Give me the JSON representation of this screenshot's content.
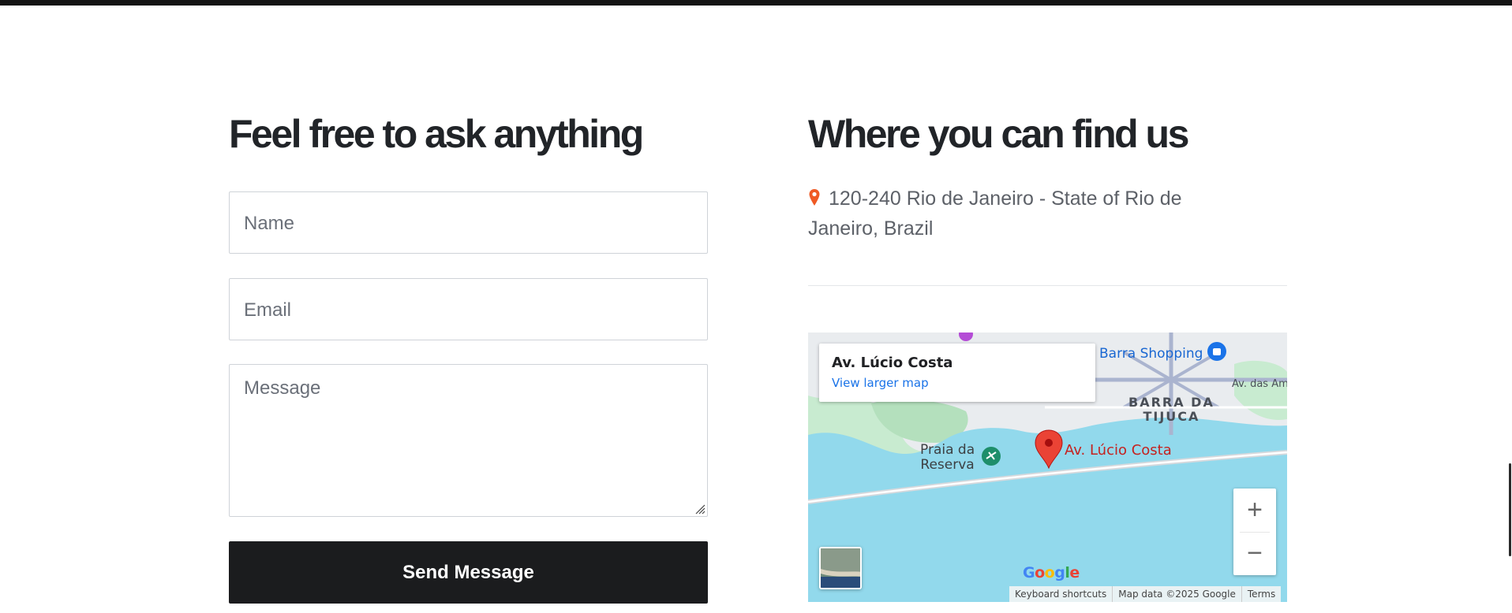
{
  "contact_form": {
    "heading": "Feel free to ask anything",
    "name_placeholder": "Name",
    "email_placeholder": "Email",
    "message_placeholder": "Message",
    "send_label": "Send Message"
  },
  "location": {
    "heading": "Where you can find us",
    "pin_icon": "map-marker-icon",
    "address": "120-240 Rio de Janeiro - State of Rio de Janeiro, Brazil"
  },
  "map": {
    "info_title": "Av. Lúcio Costa",
    "view_larger": "View larger map",
    "labels": {
      "barra_shopping": "Barra Shopping",
      "barra_da": "BARRA DA",
      "tijuca": "TIJUCA",
      "av_das": "Av. das Am",
      "praia": "Praia da",
      "reserva": "Reserva",
      "lucio": "Av. Lúcio Costa"
    },
    "zoom_in": "+",
    "zoom_out": "−",
    "logo": "Google",
    "footer": {
      "shortcuts": "Keyboard shortcuts",
      "data": "Map data ©2025 Google",
      "terms": "Terms"
    },
    "colors": {
      "water": "#92d9ec",
      "marker": "#ea4335",
      "marker_label": "#c5221f"
    }
  }
}
